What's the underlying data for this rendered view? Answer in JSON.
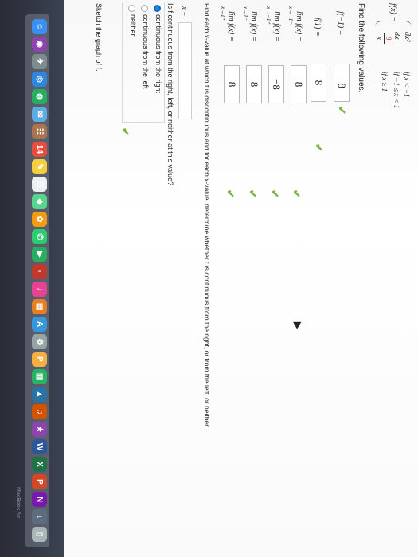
{
  "function_def": {
    "lhs": "f(x) =",
    "cases": [
      {
        "expr": "8x²",
        "cond": "if x < −1"
      },
      {
        "expr": "8x",
        "cond": "if −1 ≤ x < 1"
      },
      {
        "expr_num": "8",
        "expr_den": "x",
        "cond": "if x ≥ 1"
      }
    ]
  },
  "find_values": {
    "heading": "Find the following values.",
    "rows": [
      {
        "label": "f(−1) =",
        "sub": "",
        "answer": "−8"
      },
      {
        "label": "f(1) =",
        "sub": "",
        "answer": "8"
      },
      {
        "label": "lim  f(x) =",
        "sub": "x→−1⁻",
        "answer": "8"
      },
      {
        "label": "lim  f(x) =",
        "sub": "x→−1⁺",
        "answer": "−8"
      },
      {
        "label": "lim  f(x) =",
        "sub": "x→1⁻",
        "answer": "8"
      },
      {
        "label": "lim  f(x) =",
        "sub": "x→1⁺",
        "answer": "8"
      }
    ]
  },
  "discontinuity": {
    "prompt": "Find each x-value at which f is discontinuous and for each x-value, determine whether f is continuous from the right, or from the left, or neither.",
    "x_label": "x =",
    "x_value": "",
    "question": "Is f continuous from the right, left, or neither at this value?",
    "options": [
      {
        "label": "continuous from the right",
        "selected": true
      },
      {
        "label": "continuous from the left",
        "selected": false
      },
      {
        "label": "neither",
        "selected": false
      }
    ]
  },
  "sketch": {
    "prompt": "Sketch the graph of f."
  },
  "dock": {
    "brand": "MacBook Air",
    "apps": [
      {
        "name": "finder-icon",
        "glyph": "☺",
        "color": "#3b8ff0"
      },
      {
        "name": "siri-icon",
        "glyph": "◉",
        "color": "#8e44ad"
      },
      {
        "name": "launchpad-icon",
        "glyph": "✈",
        "color": "#7f8c8d"
      },
      {
        "name": "safari-icon",
        "glyph": "◎",
        "color": "#2e86de"
      },
      {
        "name": "chrome-icon",
        "glyph": "◍",
        "color": "#27ae60"
      },
      {
        "name": "mail-icon",
        "glyph": "✉",
        "color": "#5dade2"
      },
      {
        "name": "contacts-icon",
        "glyph": "☷",
        "color": "#a9744f"
      },
      {
        "name": "calendar-icon",
        "glyph": "14",
        "color": "#e74c3c"
      },
      {
        "name": "notes-icon",
        "glyph": "✎",
        "color": "#f4d03f"
      },
      {
        "name": "reminders-icon",
        "glyph": "☰",
        "color": "#ecf0f1"
      },
      {
        "name": "maps-icon",
        "glyph": "◆",
        "color": "#58d68d"
      },
      {
        "name": "photos-icon",
        "glyph": "✿",
        "color": "#f39c12"
      },
      {
        "name": "messages-icon",
        "glyph": "✆",
        "color": "#2ecc71"
      },
      {
        "name": "facetime-icon",
        "glyph": "▶",
        "color": "#27ae60"
      },
      {
        "name": "photobooth-icon",
        "glyph": "◐",
        "color": "#c0392b"
      },
      {
        "name": "itunes-icon",
        "glyph": "♪",
        "color": "#e84393"
      },
      {
        "name": "ibooks-icon",
        "glyph": "▤",
        "color": "#e67e22"
      },
      {
        "name": "appstore-icon",
        "glyph": "A",
        "color": "#3498db"
      },
      {
        "name": "preferences-icon",
        "glyph": "⚙",
        "color": "#95a5a6"
      },
      {
        "name": "pages-icon",
        "glyph": "P",
        "color": "#f5b041"
      },
      {
        "name": "numbers-icon",
        "glyph": "▥",
        "color": "#28b463"
      },
      {
        "name": "keynote-icon",
        "glyph": "▲",
        "color": "#2874a6"
      },
      {
        "name": "garageband-icon",
        "glyph": "♫",
        "color": "#d35400"
      },
      {
        "name": "imovie-icon",
        "glyph": "★",
        "color": "#8e44ad"
      },
      {
        "name": "word-icon",
        "glyph": "W",
        "color": "#2b579a"
      },
      {
        "name": "excel-icon",
        "glyph": "X",
        "color": "#217346"
      },
      {
        "name": "powerpoint-icon",
        "glyph": "P",
        "color": "#d24726"
      },
      {
        "name": "onenote-icon",
        "glyph": "N",
        "color": "#7719aa"
      },
      {
        "name": "downloads-icon",
        "glyph": "↓",
        "color": "#5d6d7e"
      },
      {
        "name": "trash-icon",
        "glyph": "▯",
        "color": "#aab7b8"
      }
    ]
  }
}
